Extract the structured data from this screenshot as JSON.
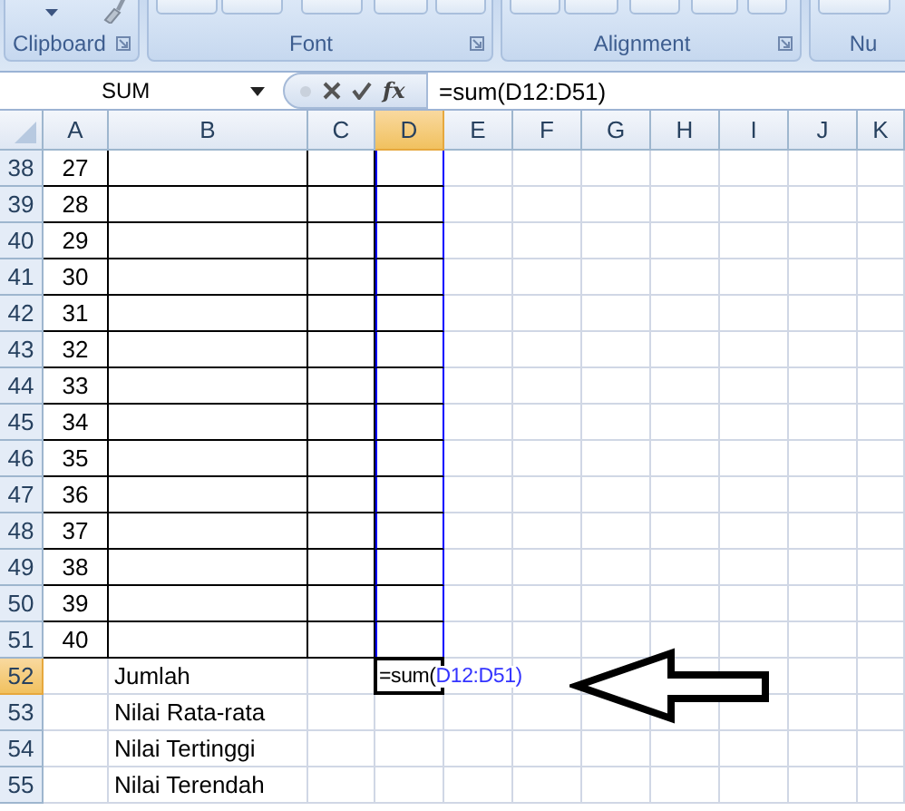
{
  "ribbon": {
    "groups": [
      {
        "label": "Clipboard",
        "launcher": true
      },
      {
        "label": "Font",
        "launcher": true
      },
      {
        "label": "Alignment",
        "launcher": true
      },
      {
        "label": "Nu",
        "launcher": false
      }
    ]
  },
  "formula_bar": {
    "name_box": "SUM",
    "function_label": "fx",
    "formula": "=sum(D12:D51)"
  },
  "columns": [
    {
      "label": "A",
      "selected": false
    },
    {
      "label": "B",
      "selected": false
    },
    {
      "label": "C",
      "selected": false
    },
    {
      "label": "D",
      "selected": true
    },
    {
      "label": "E",
      "selected": false
    },
    {
      "label": "F",
      "selected": false
    },
    {
      "label": "G",
      "selected": false
    },
    {
      "label": "H",
      "selected": false
    },
    {
      "label": "I",
      "selected": false
    },
    {
      "label": "J",
      "selected": false
    },
    {
      "label": "K",
      "selected": false
    }
  ],
  "rows": [
    {
      "number": "38",
      "selected": false,
      "bordered": true,
      "in_range": true,
      "cells": {
        "a": "27"
      }
    },
    {
      "number": "39",
      "selected": false,
      "bordered": true,
      "in_range": true,
      "cells": {
        "a": "28"
      }
    },
    {
      "number": "40",
      "selected": false,
      "bordered": true,
      "in_range": true,
      "cells": {
        "a": "29"
      }
    },
    {
      "number": "41",
      "selected": false,
      "bordered": true,
      "in_range": true,
      "cells": {
        "a": "30"
      }
    },
    {
      "number": "42",
      "selected": false,
      "bordered": true,
      "in_range": true,
      "cells": {
        "a": "31"
      }
    },
    {
      "number": "43",
      "selected": false,
      "bordered": true,
      "in_range": true,
      "cells": {
        "a": "32"
      }
    },
    {
      "number": "44",
      "selected": false,
      "bordered": true,
      "in_range": true,
      "cells": {
        "a": "33"
      }
    },
    {
      "number": "45",
      "selected": false,
      "bordered": true,
      "in_range": true,
      "cells": {
        "a": "34"
      }
    },
    {
      "number": "46",
      "selected": false,
      "bordered": true,
      "in_range": true,
      "cells": {
        "a": "35"
      }
    },
    {
      "number": "47",
      "selected": false,
      "bordered": true,
      "in_range": true,
      "cells": {
        "a": "36"
      }
    },
    {
      "number": "48",
      "selected": false,
      "bordered": true,
      "in_range": true,
      "cells": {
        "a": "37"
      }
    },
    {
      "number": "49",
      "selected": false,
      "bordered": true,
      "in_range": true,
      "cells": {
        "a": "38"
      }
    },
    {
      "number": "50",
      "selected": false,
      "bordered": true,
      "in_range": true,
      "cells": {
        "a": "39"
      }
    },
    {
      "number": "51",
      "selected": false,
      "bordered": true,
      "in_range": true,
      "cells": {
        "a": "40"
      }
    },
    {
      "number": "52",
      "selected": true,
      "bordered": false,
      "in_range": false,
      "cells": {
        "b": "Jumlah",
        "d": {
          "active": true,
          "parts": [
            {
              "kind": "plain",
              "text": "=sum("
            },
            {
              "kind": "reference",
              "text": "D12:D51)"
            }
          ]
        }
      }
    },
    {
      "number": "53",
      "selected": false,
      "bordered": false,
      "in_range": false,
      "cells": {
        "b": "Nilai Rata-rata"
      }
    },
    {
      "number": "54",
      "selected": false,
      "bordered": false,
      "in_range": false,
      "cells": {
        "b": "Nilai Tertinggi"
      }
    },
    {
      "number": "55",
      "selected": false,
      "bordered": false,
      "in_range": false,
      "cells": {
        "b": "Nilai Terendah"
      }
    }
  ]
}
